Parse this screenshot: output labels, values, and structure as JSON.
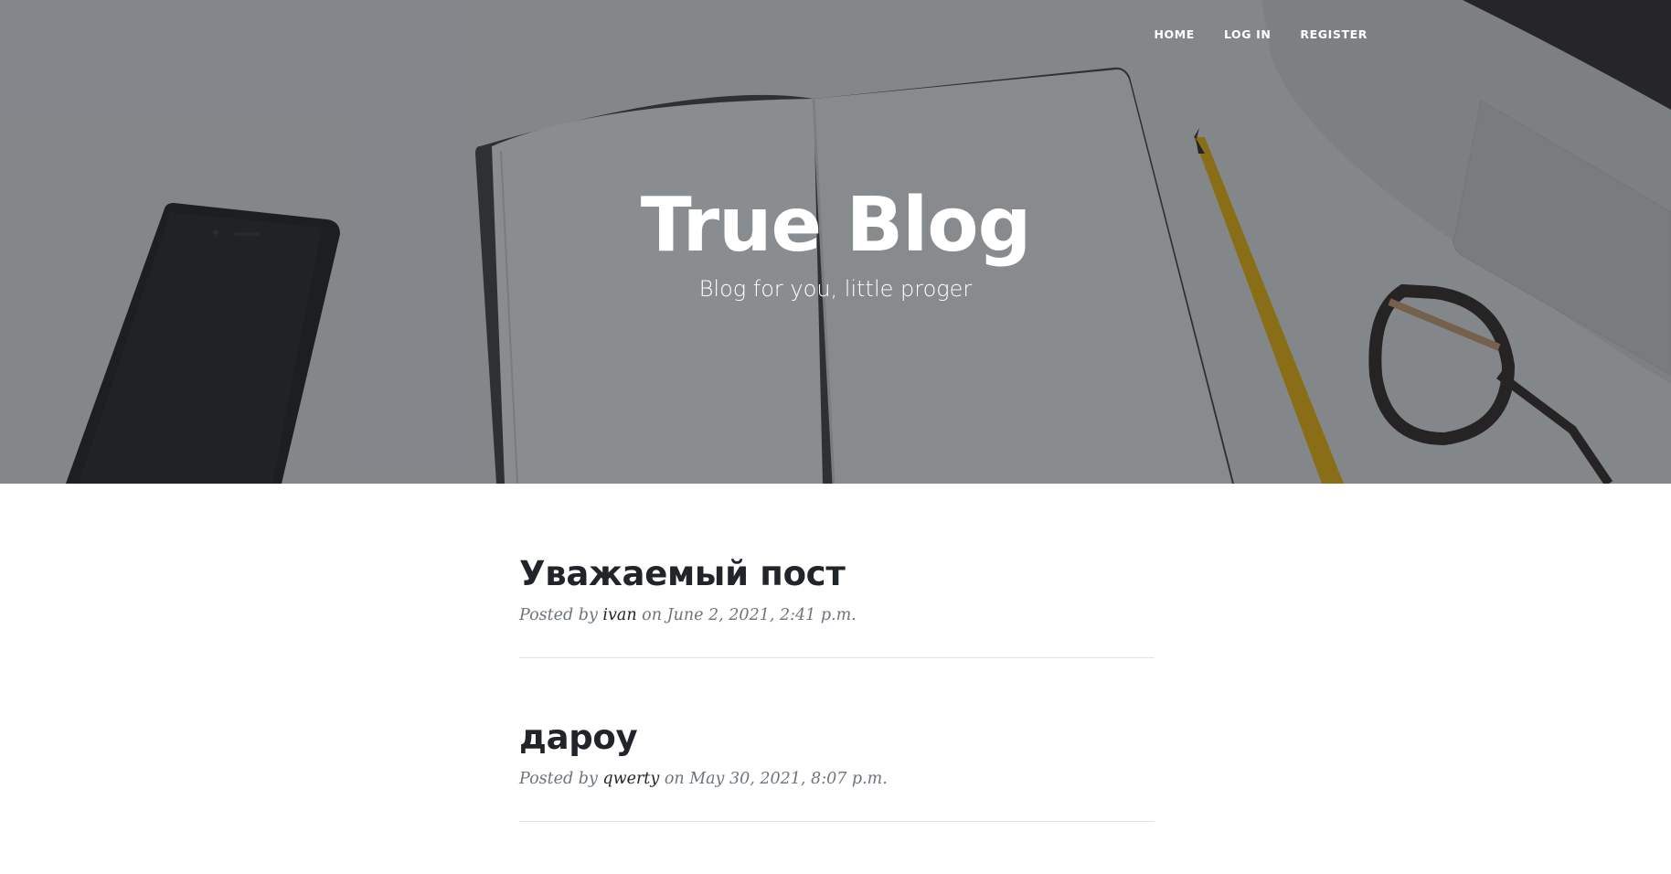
{
  "nav": {
    "items": [
      {
        "label": "HOME"
      },
      {
        "label": "LOG IN"
      },
      {
        "label": "REGISTER"
      }
    ]
  },
  "hero": {
    "title": "True Blog",
    "subtitle": "Blog for you, little proger"
  },
  "posts": [
    {
      "title": "Уважаемый пост",
      "posted_by": "Posted by",
      "author": "ivan",
      "on": "on",
      "date": "June 2, 2021, 2:41 p.m."
    },
    {
      "title": "дароу",
      "posted_by": "Posted by",
      "author": "qwerty",
      "on": "on",
      "date": "May 30, 2021, 8:07 p.m."
    }
  ],
  "colors": {
    "overlay": "#212529",
    "text_dark": "#212529",
    "text_muted": "#6c757d",
    "divider": "#e3e3e3"
  }
}
